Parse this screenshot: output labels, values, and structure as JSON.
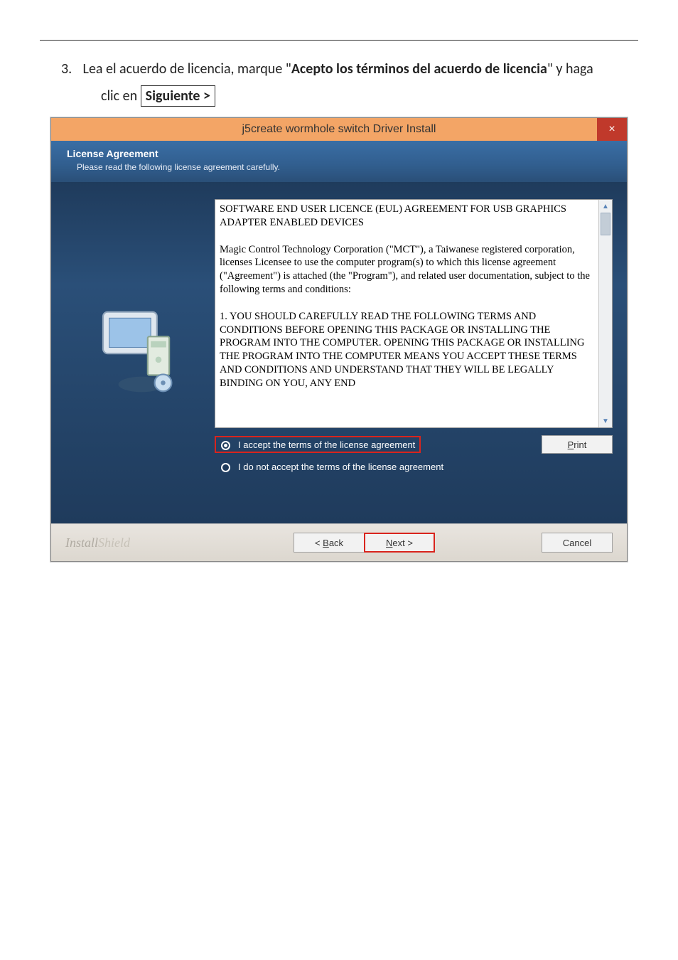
{
  "instruction": {
    "number": "3.",
    "text_before_bold1": "Lea el acuerdo de licencia, marque \"",
    "bold1": "Acepto los términos del acuerdo de licencia",
    "text_after_bold1": "\" y haga",
    "line2_prefix": "clic en",
    "boxed_button": "Siguiente >"
  },
  "window": {
    "title": "j5create wormhole switch Driver Install",
    "close": "×",
    "header_title": "License Agreement",
    "header_sub": "Please read the following license agreement carefully.",
    "license_p1": "SOFTWARE END USER LICENCE (EUL) AGREEMENT FOR USB GRAPHICS ADAPTER ENABLED DEVICES",
    "license_p2": "Magic Control Technology Corporation (\"MCT\"), a Taiwanese registered corporation, licenses Licensee to use the computer program(s) to which this license agreement (\"Agreement\") is attached (the \"Program\"), and related user documentation, subject to the following terms and conditions:",
    "license_p3": "1. YOU SHOULD CAREFULLY READ THE FOLLOWING TERMS AND CONDITIONS BEFORE OPENING THIS PACKAGE OR INSTALLING THE PROGRAM INTO THE COMPUTER. OPENING THIS PACKAGE OR INSTALLING THE PROGRAM INTO THE COMPUTER MEANS YOU ACCEPT THESE TERMS AND CONDITIONS AND UNDERSTAND THAT THEY WILL BE LEGALLY BINDING ON YOU, ANY END",
    "radio_accept": "I accept the terms of the license agreement",
    "radio_reject": "I do not accept the terms of the license agreement",
    "print_btn": "Print",
    "brand_a": "Install",
    "brand_b": "Shield",
    "back_pre": "< ",
    "back_u": "B",
    "back_post": "ack",
    "next_u": "N",
    "next_post": "ext >",
    "cancel": "Cancel"
  }
}
